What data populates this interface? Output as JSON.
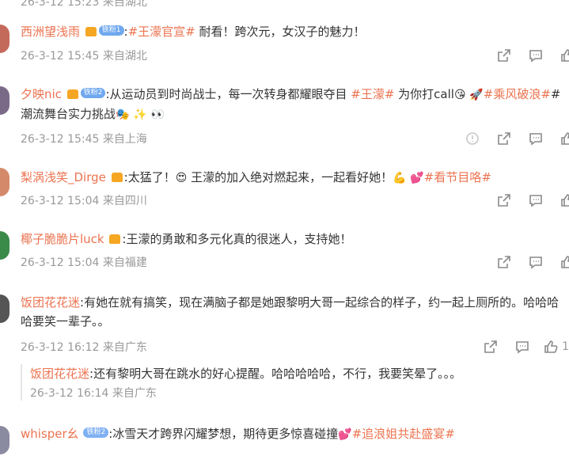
{
  "top_cut_text": "26-3-12 15:23 来自湖北",
  "comments": [
    {
      "user": "西洲望浅雨",
      "badge": "铁粉1",
      "text_pre": ":",
      "tag": "#王濛官宣#",
      "text": " 耐看！跨次元，女汉子的魅力！",
      "time": "26-3-12 15:45",
      "location": "来自湖北"
    },
    {
      "user": "夕映nic",
      "badge": "铁粉2",
      "text": ":从运动员到时尚战士，每一次转身都耀眼夺目 ",
      "tag1": "#王濛#",
      "text2": " 为你打call",
      "tag2": "#乘风破浪#",
      "text3": "#潮流舞台实力挑战",
      "time": "26-3-12 15:45",
      "location": "来自上海"
    },
    {
      "user": "梨涡浅笑_Dirge",
      "text": ":太猛了！",
      "text2": " 王濛的加入绝对燃起来，一起看好她！",
      "tag": "#看节目咯#",
      "time": "26-3-12 15:04",
      "location": "来自四川"
    },
    {
      "user": "椰子脆脆片luck",
      "text": ":王濛的勇敢和多元化真的很迷人，支持她！",
      "time": "26-3-12 15:04",
      "location": "来自福建"
    },
    {
      "user": "饭团花花迷",
      "text": ":有她在就有搞笑，现在满脑子都是她跟黎明大哥一起综合的样子，约一起上厕所的。哈哈哈哈要笑一辈子。。",
      "time": "26-3-12 16:12",
      "location": "来自广东",
      "like_count": "1"
    },
    {
      "user": "whisper幺",
      "badge": "铁粉2",
      "text": ":冰雪天才跨界闪耀梦想，期待更多惊喜碰撞",
      "tag": "#追浪姐共赴盛宴#"
    }
  ],
  "reply": {
    "user": "饭团花花迷",
    "text": ":还有黎明大哥在跳水的好心提醒。哈哈哈哈哈，不行，我要笑晕了。。。",
    "time": "26-3-12 16:14",
    "location": "来自广东"
  },
  "icons": [
    "share-icon",
    "comment-icon",
    "like-icon",
    "report-icon",
    "crown-icon"
  ],
  "colors": {
    "username": "#eb7350",
    "meta": "#999999",
    "text": "#333333",
    "fan_badge": "#6fa8ef"
  }
}
